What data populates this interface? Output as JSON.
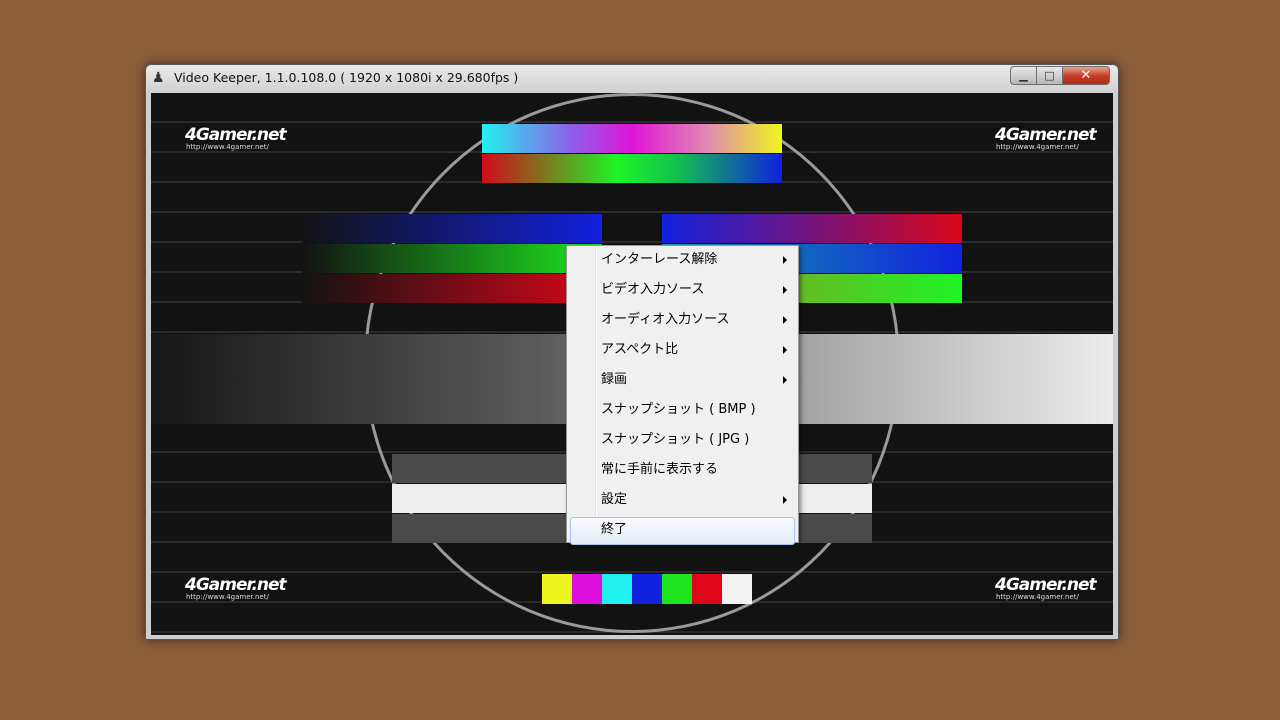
{
  "window": {
    "title": "Video Keeper, 1.1.0.108.0 ( 1920 x 1080i x 29.680fps )",
    "controls": {
      "minimize": "▁",
      "maximize": "□",
      "close": "✕"
    },
    "icon": "joystick-icon"
  },
  "video": {
    "logo_text": "4Gamer.net",
    "logo_url": "http://www.4gamer.net/",
    "color_bars": [
      "#eef51e",
      "#dc0fdc",
      "#22f0ee",
      "#1121dd",
      "#1ee51e",
      "#e0061a",
      "#f2f2f2"
    ]
  },
  "context_menu": {
    "items": [
      {
        "label": "インターレース解除",
        "submenu": true
      },
      {
        "label": "ビデオ入力ソース",
        "submenu": true
      },
      {
        "label": "オーディオ入力ソース",
        "submenu": true
      },
      {
        "label": "アスペクト比",
        "submenu": true
      },
      {
        "label": "録画",
        "submenu": true
      },
      {
        "label": "スナップショット ( BMP )",
        "submenu": false
      },
      {
        "label": "スナップショット ( JPG )",
        "submenu": false
      },
      {
        "label": "常に手前に表示する",
        "submenu": false
      },
      {
        "label": "設定",
        "submenu": true
      },
      {
        "label": "終了",
        "submenu": false,
        "highlighted": true
      }
    ]
  },
  "colors": {
    "desktop": "#8b5e3a",
    "menu_highlight": "#a9c4e6"
  }
}
